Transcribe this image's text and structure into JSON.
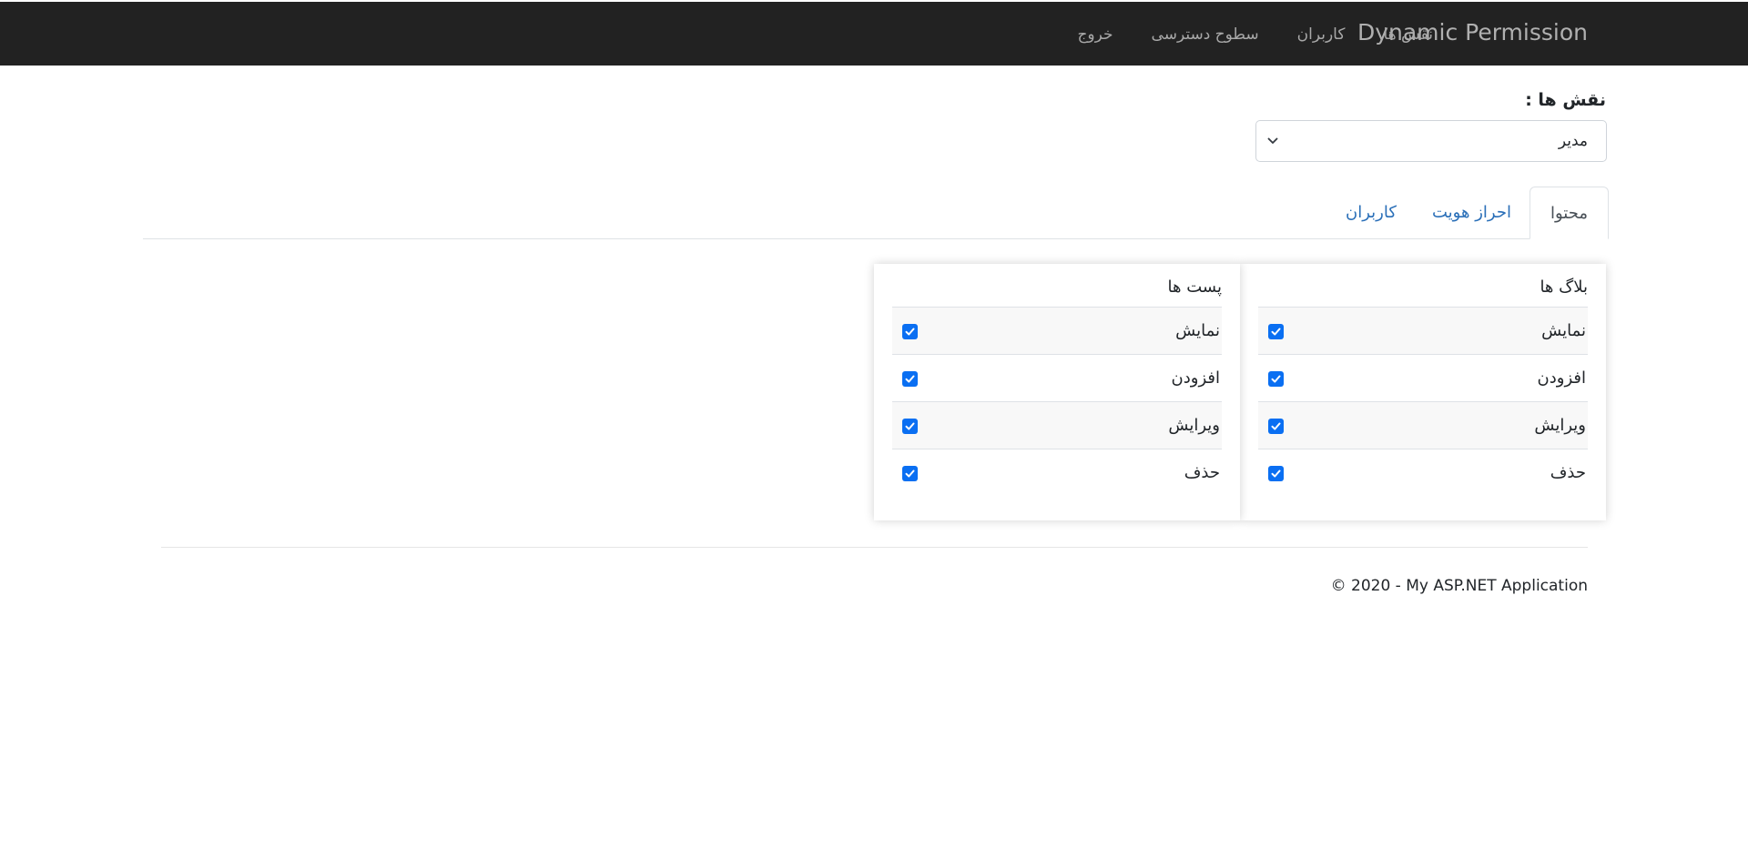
{
  "navbar": {
    "brand": "Dynamic Permission",
    "links": [
      "نقش ها",
      "کاربران",
      "سطوح دسترسی",
      "خروج"
    ]
  },
  "roles": {
    "label": "نقش ها :",
    "selected": "مدیر"
  },
  "tabs": [
    {
      "label": "محتوا",
      "active": true
    },
    {
      "label": "احراز هویت",
      "active": false
    },
    {
      "label": "کاربران",
      "active": false
    }
  ],
  "cards": [
    {
      "title": "بلاگ ها",
      "permissions": [
        {
          "label": "نمایش",
          "checked": true
        },
        {
          "label": "افزودن",
          "checked": true
        },
        {
          "label": "ویرایش",
          "checked": true
        },
        {
          "label": "حذف",
          "checked": true
        }
      ]
    },
    {
      "title": "پست ها",
      "permissions": [
        {
          "label": "نمایش",
          "checked": true
        },
        {
          "label": "افزودن",
          "checked": true
        },
        {
          "label": "ویرایش",
          "checked": true
        },
        {
          "label": "حذف",
          "checked": true
        }
      ]
    }
  ],
  "footer": {
    "text": "© 2020 - My ASP.NET Application"
  },
  "colors": {
    "navbar_bg": "#222222",
    "checkbox": "#0a6ff2",
    "tab_link": "#2a6fb8"
  }
}
